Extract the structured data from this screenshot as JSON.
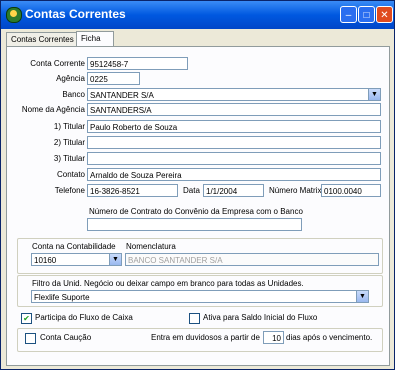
{
  "window": {
    "title": "Contas Correntes"
  },
  "tabs": [
    "Contas Correntes",
    "Ficha"
  ],
  "labels": {
    "conta_corrente": "Conta Corrente",
    "agencia": "Agência",
    "banco": "Banco",
    "nome_agencia": "Nome da Agência",
    "titular1": "1) Titular",
    "titular2": "2) Titular",
    "titular3": "3) Titular",
    "contato": "Contato",
    "telefone": "Telefone",
    "data": "Data",
    "numero_matrix": "Número Matrix",
    "numero_contrato": "Número de Contrato do Convênio da Empresa  com o Banco",
    "conta_contabilidade": "Conta na Contabilidade",
    "nomenclatura": "Nomenclatura",
    "filtro": "Filtro da Unid. Negócio ou deixar campo em branco para todas as Unidades.",
    "participa_fluxo": "Participa do Fluxo de Caixa",
    "ativa_saldo": "Ativa para Saldo Inicial do Fluxo",
    "conta_caucao": "Conta Caução",
    "entra_duvidosos": "Entra em duvidosos a partir de",
    "dias_apos": "dias após o vencimento."
  },
  "values": {
    "conta_corrente": "9512458-7",
    "agencia": "0225",
    "banco": "SANTANDER S/A",
    "nome_agencia": "SANTANDERS/A",
    "titular1": "Paulo Roberto de Souza",
    "titular2": "",
    "titular3": "",
    "contato": "Arnaldo de Souza Pereira",
    "telefone": "16-3826-8521",
    "data": "1/1/2004",
    "numero_matrix": "0100.0040",
    "numero_contrato": "",
    "conta_contabilidade": "10160",
    "nomenclatura": "BANCO SANTANDER S/A",
    "filtro": "Flexlife Suporte",
    "dias": "10"
  },
  "checks": {
    "participa_fluxo": true,
    "ativa_saldo": false,
    "conta_caucao": false
  }
}
